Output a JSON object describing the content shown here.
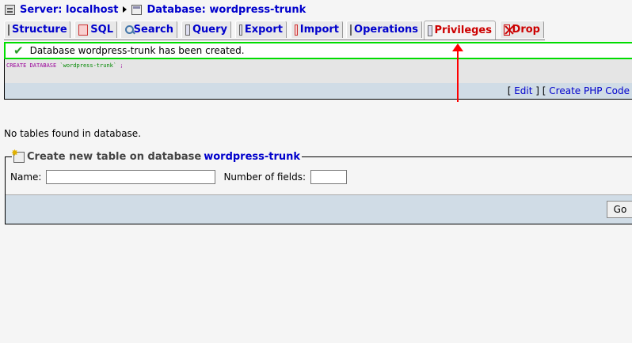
{
  "breadcrumb": {
    "server_label": "Server: localhost",
    "database_label": "Database: wordpress-trunk"
  },
  "tabs": [
    {
      "label": "Structure",
      "icon": "structure-icon"
    },
    {
      "label": "SQL",
      "icon": "sql-icon"
    },
    {
      "label": "Search",
      "icon": "search-icon"
    },
    {
      "label": "Query",
      "icon": "query-icon"
    },
    {
      "label": "Export",
      "icon": "export-icon"
    },
    {
      "label": "Import",
      "icon": "import-icon"
    },
    {
      "label": "Operations",
      "icon": "operations-icon"
    },
    {
      "label": "Privileges",
      "icon": "privileges-icon",
      "active": true
    },
    {
      "label": "Drop",
      "icon": "drop-icon"
    }
  ],
  "success": {
    "message": "Database wordpress-trunk has been created."
  },
  "sql": {
    "keyword1": "CREATE",
    "keyword2": "DATABASE",
    "name": "`wordpress-trunk`",
    "terminator": ";",
    "edit_link": "Edit",
    "php_link": "Create PHP Code"
  },
  "notice": "No tables found in database.",
  "create_table": {
    "legend_prefix": "Create new table on database",
    "legend_db": "wordpress-trunk",
    "name_label": "Name:",
    "fields_label": "Number of fields:",
    "name_value": "",
    "fields_value": "",
    "go_label": "Go"
  },
  "colors": {
    "tab_text": "#0000cc",
    "active_tab": "#cc0000",
    "success_border": "#00dd00",
    "annotation_arrow": "#ff0000"
  }
}
